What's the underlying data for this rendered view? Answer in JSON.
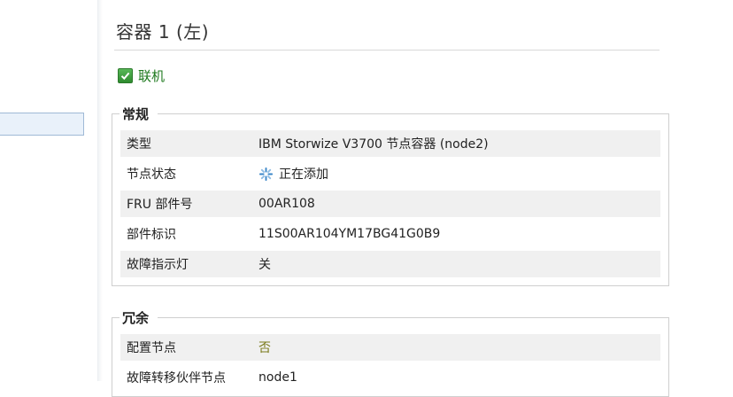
{
  "page": {
    "title": "容器 1 (左)"
  },
  "status": {
    "label": "联机",
    "icon": "check-icon",
    "color": "#1f7a1f"
  },
  "general": {
    "legend": "常规",
    "rows": [
      {
        "label": "类型",
        "value": "IBM Storwize V3700 节点容器 (node2)"
      },
      {
        "label": "节点状态",
        "value": "正在添加",
        "icon": "spinner-icon"
      },
      {
        "label": "FRU 部件号",
        "value": "00AR108"
      },
      {
        "label": "部件标识",
        "value": "11S00AR104YM17BG41G0B9"
      },
      {
        "label": "故障指示灯",
        "value": "关"
      }
    ]
  },
  "redundancy": {
    "legend": "冗余",
    "rows": [
      {
        "label": "配置节点",
        "value": "否"
      },
      {
        "label": "故障转移伙伴节点",
        "value": "node1"
      }
    ]
  }
}
